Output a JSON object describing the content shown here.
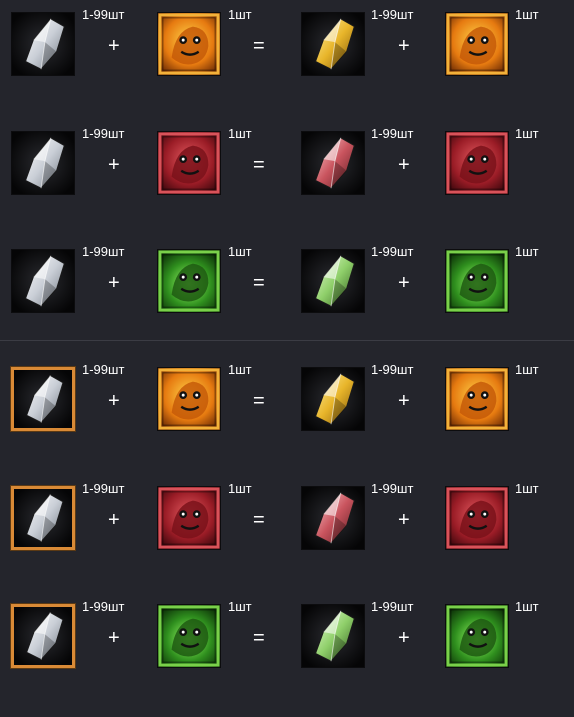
{
  "symbols": {
    "plus": "+",
    "equals": "="
  },
  "sections": [
    {
      "name": "plain-crystal",
      "rows": [
        {
          "material": "white-crystal-icon",
          "material_qty": "1-99шт",
          "beast": "golden-dragon-icon",
          "beast_qty": "1шт",
          "result": "yellow-crystal-icon",
          "result_qty": "1-99шт",
          "result_beast": "golden-dragon-icon",
          "result_beast_qty": "1шт"
        },
        {
          "material": "white-crystal-icon",
          "material_qty": "1-99шт",
          "beast": "red-beast-icon",
          "beast_qty": "1шт",
          "result": "red-crystal-icon",
          "result_qty": "1-99шт",
          "result_beast": "red-beast-icon",
          "result_beast_qty": "1шт"
        },
        {
          "material": "white-crystal-icon",
          "material_qty": "1-99шт",
          "beast": "green-beast-icon",
          "beast_qty": "1шт",
          "result": "green-crystal-icon",
          "result_qty": "1-99шт",
          "result_beast": "green-beast-icon",
          "result_beast_qty": "1шт"
        }
      ]
    },
    {
      "name": "framed-crystal",
      "rows": [
        {
          "material": "framed-white-crystal-icon",
          "material_qty": "1-99шт",
          "beast": "golden-dragon-icon",
          "beast_qty": "1шт",
          "result": "yellow-crystal-icon",
          "result_qty": "1-99шт",
          "result_beast": "golden-dragon-icon",
          "result_beast_qty": "1шт"
        },
        {
          "material": "framed-white-crystal-icon",
          "material_qty": "1-99шт",
          "beast": "red-beast-icon",
          "beast_qty": "1шт",
          "result": "red-crystal-icon",
          "result_qty": "1-99шт",
          "result_beast": "red-beast-icon",
          "result_beast_qty": "1шт"
        },
        {
          "material": "framed-white-crystal-icon",
          "material_qty": "1-99шт",
          "beast": "green-beast-icon",
          "beast_qty": "1шт",
          "result": "green-crystal-icon",
          "result_qty": "1-99шт",
          "result_beast": "green-beast-icon",
          "result_beast_qty": "1шт"
        }
      ]
    }
  ],
  "colors": {
    "background": "#24252c",
    "frame_orange": "#d98a36",
    "crystal_white": "#d9dde2",
    "crystal_yellow": "#e8b52a",
    "crystal_red": "#c9545e",
    "crystal_green": "#8fcf6a",
    "beast_gold": "#e6a020",
    "beast_red": "#b8232e",
    "beast_green": "#3fb02a"
  }
}
